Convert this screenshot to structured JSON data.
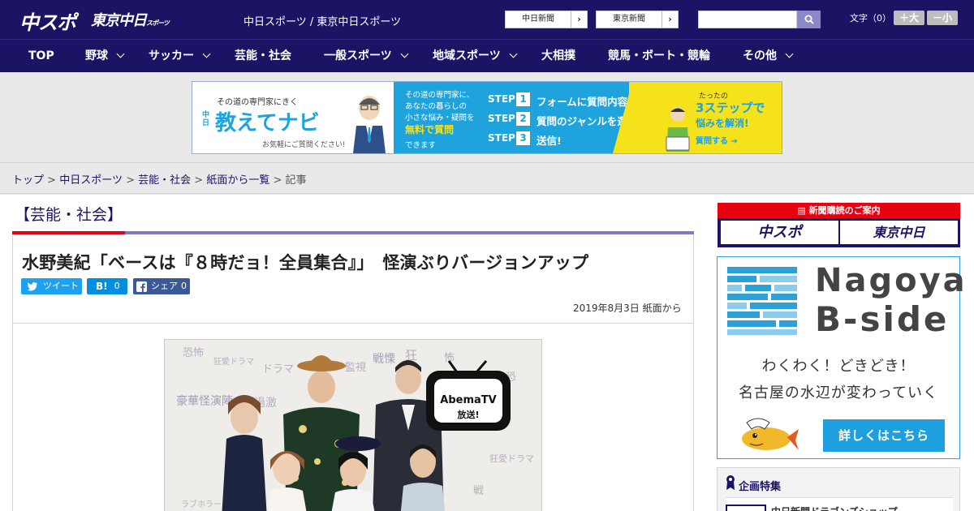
{
  "header": {
    "logo_chuspo": "中スポ",
    "logo_tokyo": "東京中日",
    "logo_tokyo_small": "スポーツ",
    "site_title": "中日スポーツ / 東京中日スポーツ",
    "link_chunichi": "中日新聞",
    "link_tokyo": "東京新聞",
    "arrow": "›",
    "search": {
      "placeholder": ""
    },
    "font_size_label": "文字（0）",
    "font_up": "＋大",
    "font_down": "－小"
  },
  "nav": [
    {
      "label": "TOP",
      "dropdown": false
    },
    {
      "label": "野球",
      "dropdown": true
    },
    {
      "label": "サッカー",
      "dropdown": true
    },
    {
      "label": "芸能・社会",
      "dropdown": false
    },
    {
      "label": "一般スポーツ",
      "dropdown": true
    },
    {
      "label": "地域スポーツ",
      "dropdown": true
    },
    {
      "label": "大相撲",
      "dropdown": false
    },
    {
      "label": "競馬・ボート・競輪",
      "dropdown": false
    },
    {
      "label": "その他",
      "dropdown": true
    }
  ],
  "ad": {
    "left_small": "その道の専門家にきく",
    "left_brand_prefix": "中日",
    "left_brand": "教えてナビ",
    "left_note": "お気軽にご質問ください!",
    "mid_line1": "その道の専門家に、",
    "mid_line2": "あなたの暮らしの",
    "mid_line3": "小さな悩み・疑問を",
    "mid_line4": "無料で質問",
    "mid_line5": "できます",
    "steps": [
      {
        "label": "STEP",
        "num": "1",
        "text": "フォームに質問内容を入力"
      },
      {
        "label": "STEP",
        "num": "2",
        "text": "質問のジャンルを選択"
      },
      {
        "label": "STEP",
        "num": "3",
        "text": "送信!"
      }
    ],
    "right_small": "たったの",
    "right_big": "3ステップで",
    "right_sub": "悩みを解消!",
    "right_btn": "質問する"
  },
  "breadcrumb": {
    "items": [
      "トップ",
      "中日スポーツ",
      "芸能・社会",
      "紙面から一覧"
    ],
    "separator": ">",
    "current": "記事"
  },
  "article": {
    "section": "【芸能・社会】",
    "headline": "水野美紀「ベースは『８時だョ！全員集合』」　怪演ぶりバージョンアップ",
    "share_tweet": "ツイート",
    "share_hatena": "B!",
    "share_hatena_count": "0",
    "share_fb": "シェア",
    "share_fb_count": "0",
    "date": "2019年8月3日 紙面から",
    "photo": {
      "tv_logo": "AbemaTV",
      "tv_sub": "放送!",
      "background_words": [
        "恐怖",
        "狂愛ドラマ",
        "監視",
        "戦慄",
        "豪華怪演陣",
        "過激",
        "ドラマ",
        "狂",
        "怖",
        "ラブホラー",
        "恐",
        "戦"
      ]
    }
  },
  "sidebar": {
    "subscription": {
      "head": "新聞購読のご案内",
      "logo1": "中スポ",
      "logo2": "東京中日"
    },
    "bside": {
      "title1": "Nagoya",
      "title2": "B-side",
      "line1": "わくわく！どきどき！",
      "line2": "名古屋の水辺が変わっていく",
      "button": "詳しくはこちら"
    },
    "kikaku": {
      "title": "企画特集",
      "item": "中日新聞ドラゴンズショップ"
    }
  },
  "colors": {
    "brand_navy": "#1b1464",
    "accent_red": "#e60012",
    "accent_purple": "#7f7bbf",
    "twitter": "#1da1f2",
    "hatena": "#008fde",
    "facebook": "#3b5998",
    "bside_blue": "#1ea0e0"
  }
}
